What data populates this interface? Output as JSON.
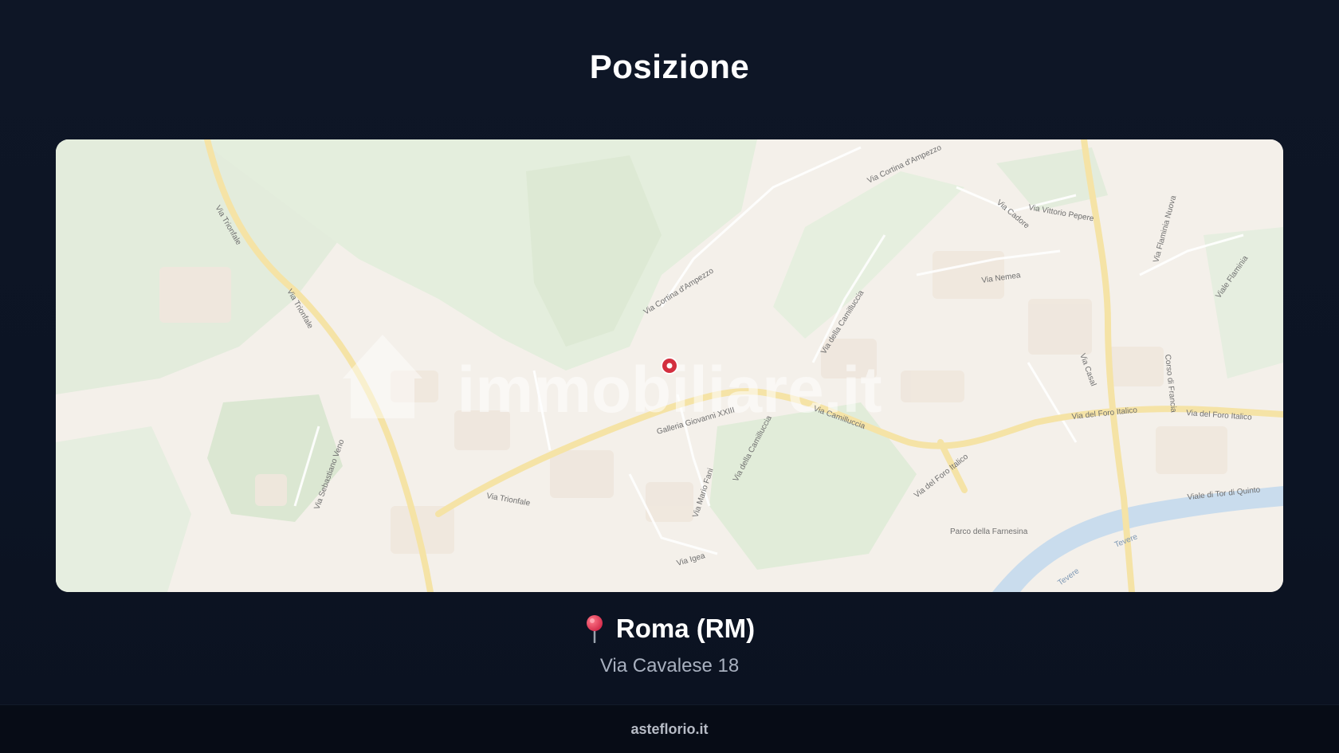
{
  "page": {
    "title": "Posizione"
  },
  "map": {
    "watermark": "immobiliare.it",
    "marker_color": "#d32f3f",
    "street_labels": [
      "Via Trionfale",
      "Via Trionfale",
      "Via Cortina d'Ampezzo",
      "Via Cortina d'Ampezzo",
      "Via Cadore",
      "Via Vittorio Pepere",
      "Via Flaminia Nuova",
      "Via Nemea",
      "Viale Flaminia",
      "Via della Camilluccia",
      "Galleria Giovanni XXIII",
      "Via Camilluccia",
      "Via del Foro Italico",
      "Via del Foro Italico",
      "Via del Foro Italico",
      "Corso di Francia",
      "Via Casal",
      "Via Mario Fani",
      "Via della Camilluccia",
      "Via Trionfale",
      "Via Igea",
      "Via Sebastiano Veno",
      "Viale di Tor di Quinto",
      "Parco della Farnesina",
      "Tevere",
      "Tevere"
    ]
  },
  "location": {
    "icon": "round-pushpin-icon",
    "city": "Roma (RM)",
    "address": "Via Cavalese 18"
  },
  "footer": {
    "text": "asteflorio.it"
  }
}
